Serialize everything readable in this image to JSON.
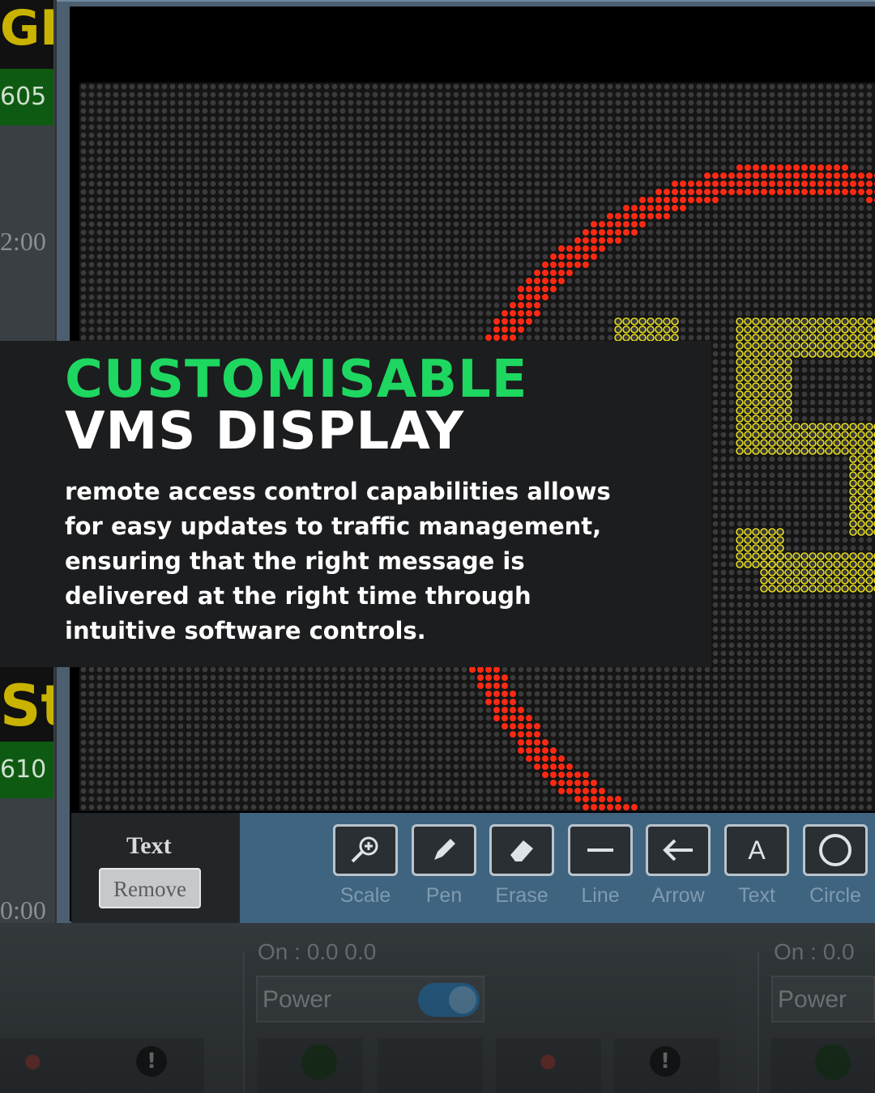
{
  "overlay": {
    "headline_green": "CUSTOMISABLE",
    "headline_white": "VMS DISPLAY",
    "body_lines": [
      "remote access control capabilities allows",
      "for easy updates to traffic management,",
      "ensuring that the right message is",
      "delivered at the right time through",
      "intuitive software controls."
    ]
  },
  "left_panel": {
    "top_code": "605",
    "top_time": "2:00",
    "bottom_code": "610",
    "bottom_time": "0:00"
  },
  "editor": {
    "text_label": "Text",
    "remove_label": "Remove",
    "tools": [
      {
        "label": "Scale",
        "icon": "zoom-icon"
      },
      {
        "label": "Pen",
        "icon": "pen-icon"
      },
      {
        "label": "Erase",
        "icon": "eraser-icon"
      },
      {
        "label": "Line",
        "icon": "line-icon"
      },
      {
        "label": "Arrow",
        "icon": "arrow-left-icon"
      },
      {
        "label": "Text",
        "icon": "text-icon"
      },
      {
        "label": "Circle",
        "icon": "circle-icon"
      }
    ],
    "colors": {
      "ring": "#ff2a14",
      "digits": "#e9df1e",
      "led_off": "#3b3b3b"
    }
  },
  "lower": {
    "onoff_left": "On : 0.0     0.0",
    "onoff_right": "On : 0.0",
    "power_label": "Power"
  }
}
